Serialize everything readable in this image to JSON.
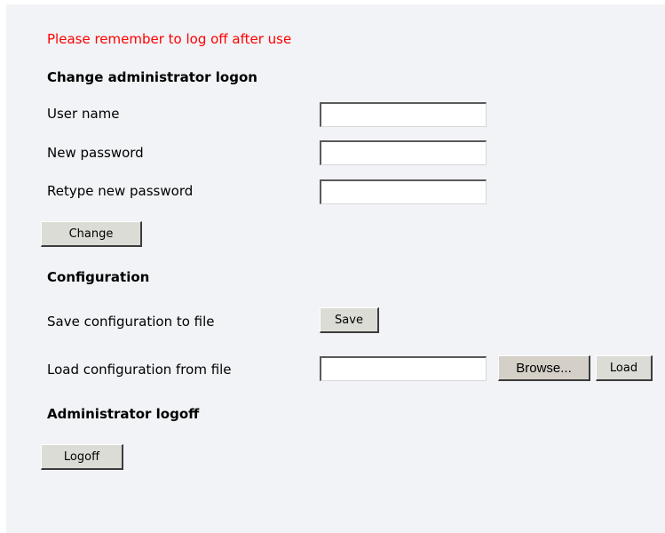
{
  "notice": "Please remember to log off after use",
  "change_logon": {
    "heading": "Change administrator logon",
    "user_name_label": "User name",
    "user_name_value": "",
    "new_password_label": "New password",
    "new_password_value": "",
    "retype_password_label": "Retype new password",
    "retype_password_value": "",
    "change_button": "Change"
  },
  "configuration": {
    "heading": "Configuration",
    "save_label": "Save configuration to file",
    "save_button": "Save",
    "load_label": "Load configuration from file",
    "load_file_value": "",
    "browse_button": "Browse...",
    "load_button": "Load"
  },
  "logoff": {
    "heading": "Administrator logoff",
    "logoff_button": "Logoff"
  },
  "colors": {
    "notice": "#ff0000",
    "panel_background": "#f1f3f6",
    "button_face": "#dcdcd6"
  }
}
